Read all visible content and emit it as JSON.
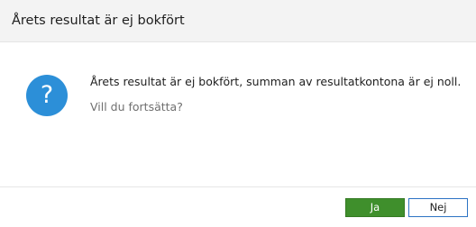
{
  "dialog": {
    "title": "Årets resultat är ej bokfört",
    "icon": "question-icon",
    "icon_glyph": "?",
    "icon_color": "#2c8fd8",
    "message": "Årets resultat är ej bokfört, summan av resultatkontona är ej noll.",
    "question": "Vill du fortsätta?"
  },
  "buttons": {
    "yes_label": "Ja",
    "no_label": "Nej",
    "yes_color": "#3f8f2c"
  }
}
